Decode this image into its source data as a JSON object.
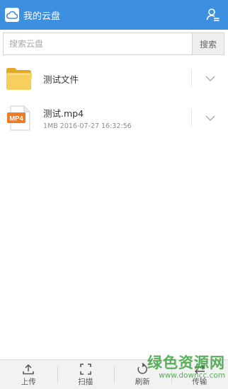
{
  "header": {
    "title": "我的云盘",
    "logo_icon": "cloud-icon",
    "user_icon": "user-icon",
    "color": "#3d8fe0"
  },
  "search": {
    "placeholder": "搜索云盘",
    "button_label": "搜索"
  },
  "files": [
    {
      "type": "folder",
      "icon": "folder-icon",
      "name": "测试文件",
      "meta": ""
    },
    {
      "type": "video",
      "icon": "mp4-file-icon",
      "badge": "MP4",
      "name": "测试.mp4",
      "meta": "1MB   2016-07-27 16:32:56"
    }
  ],
  "toolbar": {
    "upload": {
      "label": "上传",
      "icon": "upload-icon"
    },
    "scan": {
      "label": "扫描",
      "icon": "scan-icon"
    },
    "refresh": {
      "label": "刷新",
      "icon": "refresh-icon"
    },
    "transfer": {
      "label": "传输",
      "icon": "transfer-icon"
    }
  },
  "watermark": {
    "title": "绿色资源网",
    "url": "www.downcc.com"
  }
}
